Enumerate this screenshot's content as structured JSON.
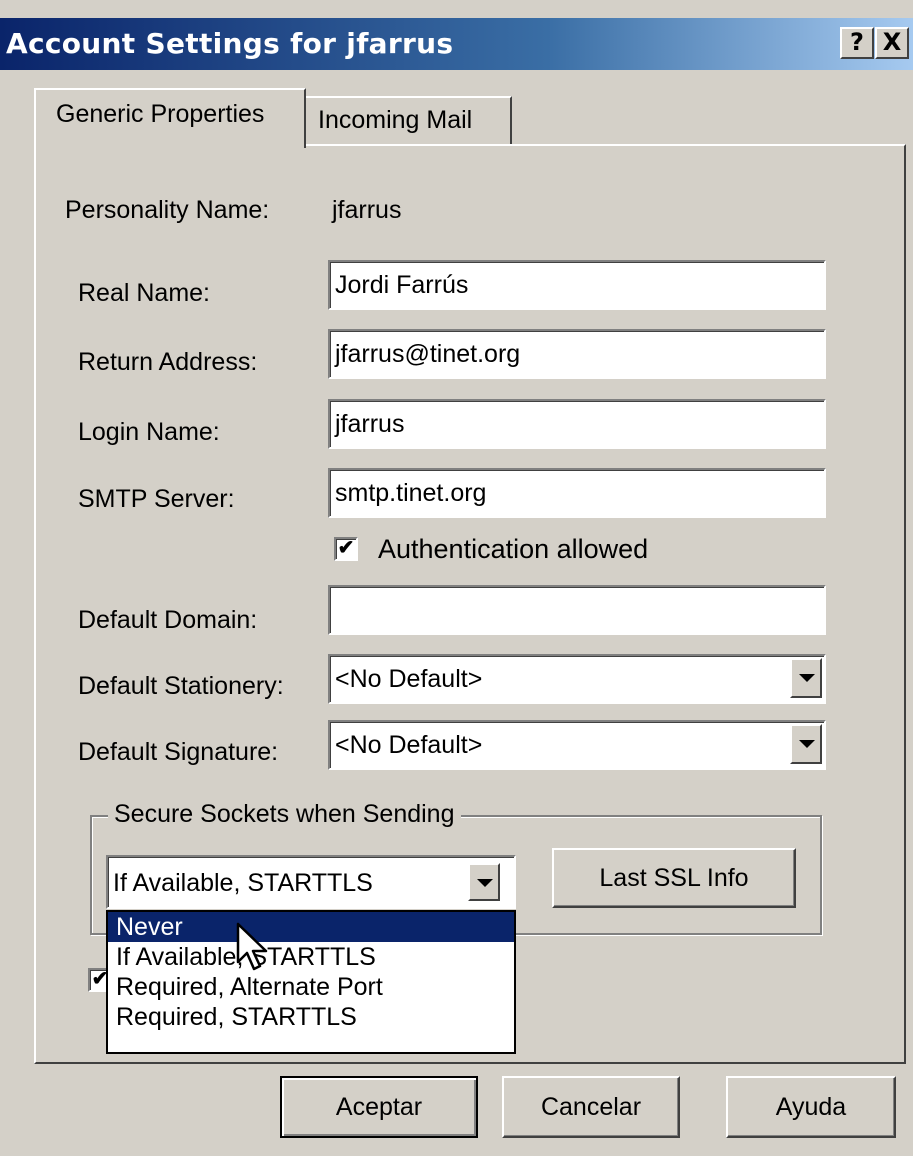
{
  "window": {
    "title": "Account Settings for jfarrus",
    "help_button": "?",
    "close_button": "X"
  },
  "tabs": [
    {
      "label": "Generic Properties",
      "active": true
    },
    {
      "label": "Incoming Mail",
      "active": false
    }
  ],
  "form": {
    "personality_label": "Personality Name:",
    "personality_value": "jfarrus",
    "real_name_label": "Real Name:",
    "real_name_value": "Jordi Farrús",
    "return_address_label": "Return Address:",
    "return_address_value": "jfarrus@tinet.org",
    "login_name_label": "Login Name:",
    "login_name_value": "jfarrus",
    "smtp_server_label": "SMTP Server:",
    "smtp_server_value": "smtp.tinet.org",
    "auth_label": "Authentication allowed",
    "auth_checked": true,
    "default_domain_label": "Default Domain:",
    "default_domain_value": "",
    "default_stationery_label": "Default Stationery:",
    "default_stationery_value": "<No Default>",
    "default_signature_label": "Default Signature:",
    "default_signature_value": "<No Default>"
  },
  "secure_sockets": {
    "group_title": "Secure Sockets when Sending",
    "selected": "If Available, STARTTLS",
    "last_ssl_button": "Last SSL Info",
    "options": [
      "Never",
      "If Available, STARTTLS",
      "Required, Alternate Port",
      "Required, STARTTLS"
    ],
    "highlighted": "Never"
  },
  "buttons": {
    "ok": "Aceptar",
    "cancel": "Cancelar",
    "help": "Ayuda"
  }
}
